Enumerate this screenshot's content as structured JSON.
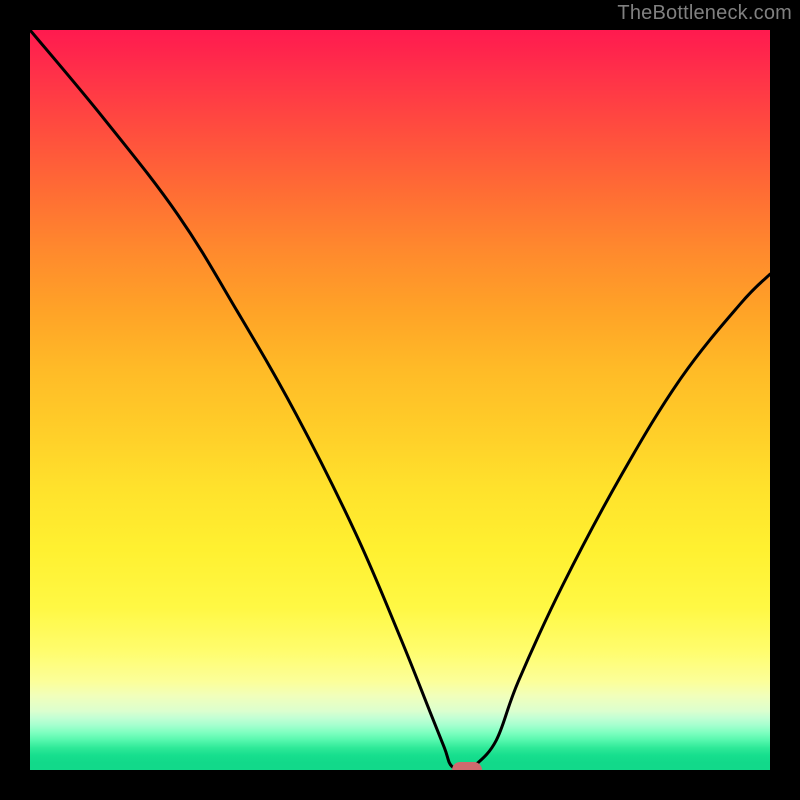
{
  "watermark": "TheBottleneck.com",
  "chart_data": {
    "type": "line",
    "title": "",
    "xlabel": "",
    "ylabel": "",
    "xlim": [
      0,
      100
    ],
    "ylim": [
      0,
      100
    ],
    "x": [
      0,
      10,
      20,
      28,
      36,
      44,
      50,
      54,
      56,
      57,
      59,
      60,
      63,
      66,
      72,
      80,
      88,
      96,
      100
    ],
    "values": [
      100,
      88,
      75,
      62,
      48,
      32,
      18,
      8,
      3,
      0.5,
      0,
      0.5,
      4,
      12,
      25,
      40,
      53,
      63,
      67
    ],
    "minimum_marker": {
      "x": 59,
      "y": 0
    },
    "gradient_stops": [
      {
        "pos": 0,
        "color": "#ff1a4f"
      },
      {
        "pos": 5,
        "color": "#ff2d4a"
      },
      {
        "pos": 13,
        "color": "#ff4b3f"
      },
      {
        "pos": 22,
        "color": "#ff6d34"
      },
      {
        "pos": 30,
        "color": "#ff8a2d"
      },
      {
        "pos": 38,
        "color": "#ffa327"
      },
      {
        "pos": 46,
        "color": "#ffbb27"
      },
      {
        "pos": 55,
        "color": "#ffd029"
      },
      {
        "pos": 62,
        "color": "#ffe22c"
      },
      {
        "pos": 70,
        "color": "#fff030"
      },
      {
        "pos": 78,
        "color": "#fff844"
      },
      {
        "pos": 84,
        "color": "#fffd6e"
      },
      {
        "pos": 88,
        "color": "#fcff99"
      },
      {
        "pos": 90,
        "color": "#f1ffbb"
      },
      {
        "pos": 92,
        "color": "#dcffce"
      },
      {
        "pos": 93,
        "color": "#c1ffd4"
      },
      {
        "pos": 94,
        "color": "#a3ffce"
      },
      {
        "pos": 95,
        "color": "#7cffbf"
      },
      {
        "pos": 96,
        "color": "#55f7ad"
      },
      {
        "pos": 97,
        "color": "#2fe998"
      },
      {
        "pos": 98,
        "color": "#17df8e"
      },
      {
        "pos": 99,
        "color": "#12d98a"
      },
      {
        "pos": 100,
        "color": "#12d98a"
      }
    ],
    "marker_color": "#cf6b6e",
    "line_color": "#000000"
  }
}
